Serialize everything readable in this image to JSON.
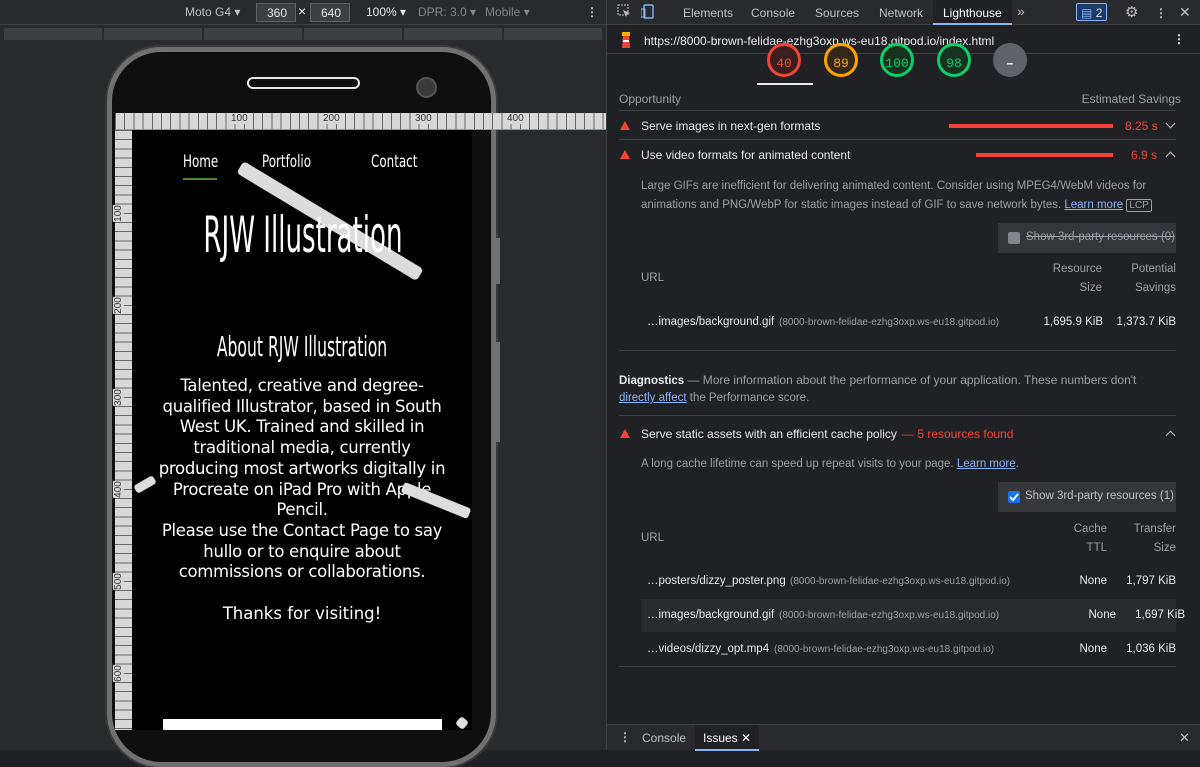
{
  "device_toolbar": {
    "device": "Moto G4",
    "width": "360",
    "height": "640",
    "zoom": "100%",
    "dpr": "DPR: 3.0",
    "mode": "Mobile"
  },
  "ruler": {
    "labels": [
      "100",
      "200",
      "300",
      "400"
    ],
    "vlabels": [
      "100",
      "200",
      "300",
      "400",
      "500",
      "600"
    ]
  },
  "site": {
    "nav": [
      "Home",
      "Portfolio",
      "Contact"
    ],
    "brand": "RJW Illustration",
    "about_title": "About RJW Illustration",
    "para1": "Talented, creative and degree-qualified Illustrator, based in South West UK. Trained and skilled in traditional media, currently producing most artworks digitally in Procreate on iPad Pro with Apple Pencil.",
    "para2": "Please use the Contact Page to say hullo or to enquire about commissions or collaborations.",
    "para3": "Thanks for visiting!"
  },
  "devtools": {
    "tabs": [
      "Elements",
      "Console",
      "Sources",
      "Network",
      "Lighthouse"
    ],
    "active_tab": "Lighthouse",
    "issues_count": "2",
    "url": "https://8000-brown-felidae-ezhg3oxp.ws-eu18.gitpod.io/index.html",
    "scores": [
      {
        "value": "40",
        "color": "#f44336"
      },
      {
        "value": "89",
        "color": "#ffa400"
      },
      {
        "value": "100",
        "color": "#0cce6b"
      },
      {
        "value": "98",
        "color": "#0cce6b"
      }
    ],
    "opportunity_label": "Opportunity",
    "savings_label": "Estimated Savings",
    "audit1": {
      "title": "Serve images in next-gen formats",
      "value": "8.25 s"
    },
    "audit2": {
      "title": "Use video formats for animated content",
      "value": "6.9 s",
      "desc1": "Large GIFs are inefficient for delivering animated content. Consider using MPEG4/WebM videos for",
      "desc2": "animations and PNG/WebP for static images instead of GIF to save network bytes.",
      "learn": "Learn more",
      "badge": "LCP",
      "third_party": "Show 3rd-party resources",
      "third_party_count": "(0)",
      "col_url": "URL",
      "col_res1": "Resource",
      "col_res2": "Size",
      "col_pot1": "Potential",
      "col_pot2": "Savings",
      "row_url": "…images/background.gif",
      "row_host": "(8000-brown-felidae-ezhg3oxp.ws-eu18.gitpod.io)",
      "row_size": "1,695.9 KiB",
      "row_sav": "1,373.7 KiB"
    },
    "diagnostics": {
      "label": "Diagnostics",
      "text1": "— More information about the performance of your application. These numbers don't",
      "link": "directly affect",
      "text2": "the Performance score."
    },
    "audit3": {
      "title": "Serve static assets with an efficient cache policy",
      "found": "— 5 resources found",
      "desc": "A long cache lifetime can speed up repeat visits to your page.",
      "learn": "Learn more",
      "third_party": "Show 3rd-party resources (1)",
      "col_url": "URL",
      "col_cache1": "Cache",
      "col_cache2": "TTL",
      "col_tr1": "Transfer",
      "col_tr2": "Size",
      "rows": [
        {
          "url": "…posters/dizzy_poster.png",
          "host": "(8000-brown-felidae-ezhg3oxp.ws-eu18.gitpod.io)",
          "ttl": "None",
          "size": "1,797 KiB"
        },
        {
          "url": "…images/background.gif",
          "host": "(8000-brown-felidae-ezhg3oxp.ws-eu18.gitpod.io)",
          "ttl": "None",
          "size": "1,697 KiB"
        },
        {
          "url": "…videos/dizzy_opt.mp4",
          "host": "(8000-brown-felidae-ezhg3oxp.ws-eu18.gitpod.io)",
          "ttl": "None",
          "size": "1,036 KiB"
        }
      ]
    },
    "drawer": {
      "console": "Console",
      "issues": "Issues"
    }
  }
}
